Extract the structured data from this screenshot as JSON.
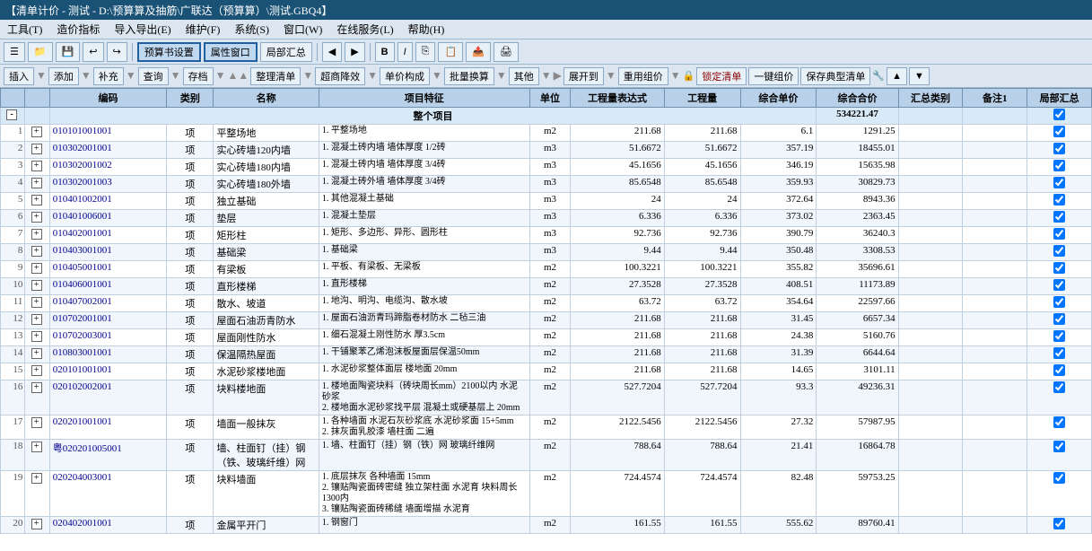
{
  "titlebar": {
    "text": "【清单计价 - 测试 - D:\\预算算及抽筋\\广联达（预算算）\\测试.GBQ4】"
  },
  "menubar": {
    "items": [
      "工具(T)",
      "造价指标",
      "导入导出(E)",
      "维护(F)",
      "系统(S)",
      "窗口(W)",
      "在线服务(L)",
      "帮助(H)"
    ]
  },
  "toolbar1": {
    "buttons": [
      "预算书设置",
      "属性窗口",
      "局部汇总"
    ]
  },
  "toolbar2": {
    "buttons": [
      "插入",
      "添加",
      "补充",
      "查询",
      "存档",
      "整理清单",
      "超商降效",
      "单价构成",
      "批量换算",
      "其他",
      "展开到",
      "重用组价",
      "锁定清单",
      "一键组价",
      "保存典型清单"
    ]
  },
  "table": {
    "headers": [
      "编码",
      "类别",
      "名称",
      "项目特征",
      "单位",
      "工程量表达式",
      "工程量",
      "综合单价",
      "综合合价",
      "汇总类别",
      "备注1",
      "局部汇总"
    ],
    "total_row": {
      "label": "整个项目",
      "total": "534221.47"
    },
    "rows": [
      {
        "num": "1",
        "expand": "+",
        "bianhao": "010101001001",
        "leibie": "项",
        "mingcheng": "平整场地",
        "xiangmu": "1. 平整场地",
        "danwei": "m2",
        "biaodashi": "211.68",
        "gongchengliang": "211.68",
        "zonghe_danjia": "6.1",
        "zonghe_jiage": "1291.25",
        "huizong": "",
        "beizhu": "",
        "jubuhui": true
      },
      {
        "num": "2",
        "expand": "+",
        "bianhao": "010302001001",
        "leibie": "项",
        "mingcheng": "实心砖墙120内墙",
        "xiangmu": "1. 混凝土砖内墙 墙体厚度 1/2砖",
        "danwei": "m3",
        "biaodashi": "51.6672",
        "gongchengliang": "51.6672",
        "zonghe_danjia": "357.19",
        "zonghe_jiage": "18455.01",
        "huizong": "",
        "beizhu": "",
        "jubuhui": true
      },
      {
        "num": "3",
        "expand": "+",
        "bianhao": "010302001002",
        "leibie": "项",
        "mingcheng": "实心砖墙180内墙",
        "xiangmu": "1. 混凝土砖内墙 墙体厚度 3/4砖",
        "danwei": "m3",
        "biaodashi": "45.1656",
        "gongchengliang": "45.1656",
        "zonghe_danjia": "346.19",
        "zonghe_jiage": "15635.98",
        "huizong": "",
        "beizhu": "",
        "jubuhui": true
      },
      {
        "num": "4",
        "expand": "+",
        "bianhao": "010302001003",
        "leibie": "项",
        "mingcheng": "实心砖墙180外墙",
        "xiangmu": "1. 混凝土砖外墙 墙体厚度 3/4砖",
        "danwei": "m3",
        "biaodashi": "85.6548",
        "gongchengliang": "85.6548",
        "zonghe_danjia": "359.93",
        "zonghe_jiage": "30829.73",
        "huizong": "",
        "beizhu": "",
        "jubuhui": true
      },
      {
        "num": "5",
        "expand": "+",
        "bianhao": "010401002001",
        "leibie": "项",
        "mingcheng": "独立基础",
        "xiangmu": "1. 其他混凝土基础",
        "danwei": "m3",
        "biaodashi": "24",
        "gongchengliang": "24",
        "zonghe_danjia": "372.64",
        "zonghe_jiage": "8943.36",
        "huizong": "",
        "beizhu": "",
        "jubuhui": true
      },
      {
        "num": "6",
        "expand": "+",
        "bianhao": "010401006001",
        "leibie": "项",
        "mingcheng": "垫层",
        "xiangmu": "1. 混凝土垫层",
        "danwei": "m3",
        "biaodashi": "6.336",
        "gongchengliang": "6.336",
        "zonghe_danjia": "373.02",
        "zonghe_jiage": "2363.45",
        "huizong": "",
        "beizhu": "",
        "jubuhui": true
      },
      {
        "num": "7",
        "expand": "+",
        "bianhao": "010402001001",
        "leibie": "项",
        "mingcheng": "矩形柱",
        "xiangmu": "1. 矩形、多边形、异形、圆形柱",
        "danwei": "m3",
        "biaodashi": "92.736",
        "gongchengliang": "92.736",
        "zonghe_danjia": "390.79",
        "zonghe_jiage": "36240.3",
        "huizong": "",
        "beizhu": "",
        "jubuhui": true
      },
      {
        "num": "8",
        "expand": "+",
        "bianhao": "010403001001",
        "leibie": "项",
        "mingcheng": "基础梁",
        "xiangmu": "1. 基础梁",
        "danwei": "m3",
        "biaodashi": "9.44",
        "gongchengliang": "9.44",
        "zonghe_danjia": "350.48",
        "zonghe_jiage": "3308.53",
        "huizong": "",
        "beizhu": "",
        "jubuhui": true
      },
      {
        "num": "9",
        "expand": "+",
        "bianhao": "010405001001",
        "leibie": "项",
        "mingcheng": "有梁板",
        "xiangmu": "1. 平板、有梁板、无梁板",
        "danwei": "m2",
        "biaodashi": "100.3221",
        "gongchengliang": "100.3221",
        "zonghe_danjia": "355.82",
        "zonghe_jiage": "35696.61",
        "huizong": "",
        "beizhu": "",
        "jubuhui": true
      },
      {
        "num": "10",
        "expand": "+",
        "bianhao": "010406001001",
        "leibie": "项",
        "mingcheng": "直形楼梯",
        "xiangmu": "1. 直形楼梯",
        "danwei": "m2",
        "biaodashi": "27.3528",
        "gongchengliang": "27.3528",
        "zonghe_danjia": "408.51",
        "zonghe_jiage": "11173.89",
        "huizong": "",
        "beizhu": "",
        "jubuhui": true
      },
      {
        "num": "11",
        "expand": "+",
        "bianhao": "010407002001",
        "leibie": "项",
        "mingcheng": "散水、坡道",
        "xiangmu": "1. 地沟、明沟、电缆沟、散水坡",
        "danwei": "m2",
        "biaodashi": "63.72",
        "gongchengliang": "63.72",
        "zonghe_danjia": "354.64",
        "zonghe_jiage": "22597.66",
        "huizong": "",
        "beizhu": "",
        "jubuhui": true
      },
      {
        "num": "12",
        "expand": "+",
        "bianhao": "010702001001",
        "leibie": "项",
        "mingcheng": "屋面石油沥青防水",
        "xiangmu": "1. 屋面石油沥青玛蹄脂卷材防水 二毡三油",
        "danwei": "m2",
        "biaodashi": "211.68",
        "gongchengliang": "211.68",
        "zonghe_danjia": "31.45",
        "zonghe_jiage": "6657.34",
        "huizong": "",
        "beizhu": "",
        "jubuhui": true
      },
      {
        "num": "13",
        "expand": "+",
        "bianhao": "010702003001",
        "leibie": "项",
        "mingcheng": "屋面刚性防水",
        "xiangmu": "1. 细石混凝土刚性防水 厚3.5cm",
        "danwei": "m2",
        "biaodashi": "211.68",
        "gongchengliang": "211.68",
        "zonghe_danjia": "24.38",
        "zonghe_jiage": "5160.76",
        "huizong": "",
        "beizhu": "",
        "jubuhui": true
      },
      {
        "num": "14",
        "expand": "+",
        "bianhao": "010803001001",
        "leibie": "项",
        "mingcheng": "保温隔热屋面",
        "xiangmu": "1. 干铺聚苯乙烯泡沫板屋面层保温50mm",
        "danwei": "m2",
        "biaodashi": "211.68",
        "gongchengliang": "211.68",
        "zonghe_danjia": "31.39",
        "zonghe_jiage": "6644.64",
        "huizong": "",
        "beizhu": "",
        "jubuhui": true
      },
      {
        "num": "15",
        "expand": "+",
        "bianhao": "020101001001",
        "leibie": "项",
        "mingcheng": "水泥砂浆楼地面",
        "xiangmu": "1. 水泥砂浆整体面层 楼地面 20mm",
        "danwei": "m2",
        "biaodashi": "211.68",
        "gongchengliang": "211.68",
        "zonghe_danjia": "14.65",
        "zonghe_jiage": "3101.11",
        "huizong": "",
        "beizhu": "",
        "jubuhui": true
      },
      {
        "num": "16",
        "expand": "+",
        "bianhao": "020102002001",
        "leibie": "项",
        "mingcheng": "块料楼地面",
        "xiangmu": "1. 楼地面陶瓷块料（砖块周长mm）2100以内 水泥砂浆\n2. 楼地面水泥砂浆找平层 混凝土或硬基层上 20mm",
        "danwei": "m2",
        "biaodashi": "527.7204",
        "gongchengliang": "527.7204",
        "zonghe_danjia": "93.3",
        "zonghe_jiage": "49236.31",
        "huizong": "",
        "beizhu": "",
        "jubuhui": true
      },
      {
        "num": "17",
        "expand": "+",
        "bianhao": "020201001001",
        "leibie": "项",
        "mingcheng": "墙面一般抹灰",
        "xiangmu": "1. 各种墙面 水泥石灰砂浆底 水泥砂浆面 15+5mm\n2. 抹灰面乳胶漆 墙柱面 二遍",
        "danwei": "m2",
        "biaodashi": "2122.5456",
        "gongchengliang": "2122.5456",
        "zonghe_danjia": "27.32",
        "zonghe_jiage": "57987.95",
        "huizong": "",
        "beizhu": "",
        "jubuhui": true
      },
      {
        "num": "18",
        "expand": "+",
        "bianhao": "粤020201005001",
        "leibie": "项",
        "mingcheng": "墙、柱面钉（挂）钢（铁、玻璃纤维）网",
        "xiangmu": "1. 墙、柱面钉（挂）钢（铁）网 玻璃纤维网",
        "danwei": "m2",
        "biaodashi": "788.64",
        "gongchengliang": "788.64",
        "zonghe_danjia": "21.41",
        "zonghe_jiage": "16864.78",
        "huizong": "",
        "beizhu": "",
        "jubuhui": true
      },
      {
        "num": "19",
        "expand": "+",
        "bianhao": "020204003001",
        "leibie": "项",
        "mingcheng": "块料墙面",
        "xiangmu": "1. 底层抹灰 各种墙面 15mm\n2. 镶贴陶瓷面砖密缝 独立架柱面 水泥育 块料周长1300内\n3. 镶贴陶瓷面砖稀缝 墙面增描 水泥育",
        "danwei": "m2",
        "biaodashi": "724.4574",
        "gongchengliang": "724.4574",
        "zonghe_danjia": "82.48",
        "zonghe_jiage": "59753.25",
        "huizong": "",
        "beizhu": "",
        "jubuhui": true
      },
      {
        "num": "20",
        "expand": "+",
        "bianhao": "020402001001",
        "leibie": "项",
        "mingcheng": "金属平开门",
        "xiangmu": "1. 钢窗门",
        "danwei": "m2",
        "biaodashi": "161.55",
        "gongchengliang": "161.55",
        "zonghe_danjia": "555.62",
        "zonghe_jiage": "89760.41",
        "huizong": "",
        "beizhu": "",
        "jubuhui": true
      }
    ]
  }
}
